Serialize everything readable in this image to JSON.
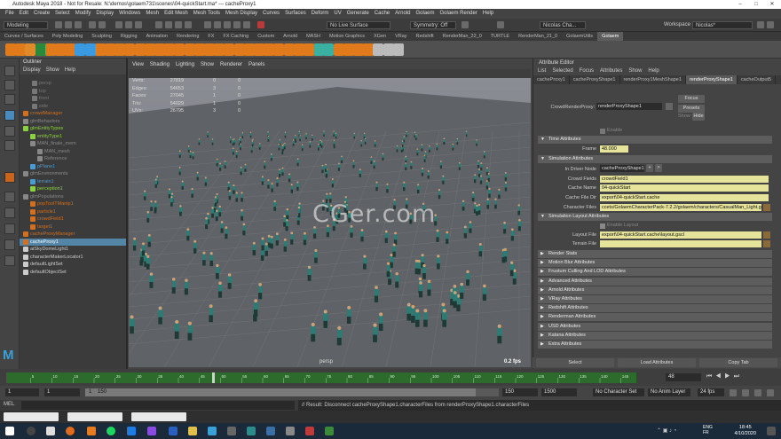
{
  "window": {
    "title": "Autodesk Maya 2018 - Not for Resale: N:\\demos\\golaem731\\scenes\\04-quickStart.ma* --- cacheProxy1"
  },
  "menubar": [
    "File",
    "Edit",
    "Create",
    "Select",
    "Modify",
    "Display",
    "Windows",
    "Mesh",
    "Edit Mesh",
    "Mesh Tools",
    "Mesh Display",
    "Curves",
    "Surfaces",
    "Deform",
    "UV",
    "Generate",
    "Cache",
    "Arnold",
    "Golaem",
    "Golaem Render",
    "Help"
  ],
  "status": {
    "mode": "Modeling",
    "no_live_surface": "No Live Surface",
    "symmetry": "Symmetry: Off",
    "user": "Nicolas Cha...",
    "workspace_label": "Workspace :",
    "workspace": "Nicolas*"
  },
  "shelf_tabs": [
    "Curves / Surfaces",
    "Poly Modeling",
    "Sculpting",
    "Rigging",
    "Animation",
    "Rendering",
    "FX",
    "FX Caching",
    "Custom",
    "Arnold",
    "MASH",
    "Motion Graphics",
    "XGen",
    "VRay",
    "Redshift",
    "RenderMan_22_0",
    "TURTLE",
    "RenderMan_21_0",
    "GolaemUtils",
    "Golaem"
  ],
  "shelf_active": "Golaem",
  "outliner": {
    "title": "Outliner",
    "menu": [
      "Display",
      "Show",
      "Help"
    ],
    "items": [
      {
        "label": "persp",
        "color": "#777"
      },
      {
        "label": "top",
        "color": "#777"
      },
      {
        "label": "front",
        "color": "#777"
      },
      {
        "label": "side",
        "color": "#777"
      },
      {
        "label": "crowdManager",
        "color": "#d07020"
      },
      {
        "label": "glmBehaviors",
        "color": "#888"
      },
      {
        "label": "glmEntityTypes",
        "color": "#8bd040"
      },
      {
        "label": "entityType1",
        "color": "#8bd040"
      },
      {
        "label": "MAN_finale_mem",
        "color": "#888"
      },
      {
        "label": "MAN_mesh",
        "color": "#888"
      },
      {
        "label": "Reference",
        "color": "#888"
      },
      {
        "label": "pPlane1",
        "color": "#4a9bd0"
      },
      {
        "label": "glmEnvironments",
        "color": "#888"
      },
      {
        "label": "terrain1",
        "color": "#4a9bd0"
      },
      {
        "label": "perception1",
        "color": "#8bd040"
      },
      {
        "label": "glmPopulations",
        "color": "#888"
      },
      {
        "label": "popToolTManip1",
        "color": "#d07020"
      },
      {
        "label": "particle1",
        "color": "#d07020"
      },
      {
        "label": "crowdField1",
        "color": "#d07020"
      },
      {
        "label": "target1",
        "color": "#d07020"
      },
      {
        "label": "cacheProxyManager",
        "color": "#d07020"
      },
      {
        "label": "cacheProxy1",
        "color": "#d07020",
        "selected": true
      },
      {
        "label": "aiSkyDomeLight1",
        "color": "#ccc"
      },
      {
        "label": "characterMakerLocator1",
        "color": "#ccc"
      },
      {
        "label": "defaultLightSet",
        "color": "#ccc"
      },
      {
        "label": "defaultObjectSet",
        "color": "#ccc"
      }
    ]
  },
  "viewport": {
    "menu": [
      "View",
      "Shading",
      "Lighting",
      "Show",
      "Renderer",
      "Panels"
    ],
    "hud": [
      {
        "name": "Verts:",
        "v1": "27819",
        "v2": "0",
        "v3": "0"
      },
      {
        "name": "Edges:",
        "v1": "54653",
        "v2": "3",
        "v3": "0"
      },
      {
        "name": "Faces:",
        "v1": "27045",
        "v2": "1",
        "v3": "0"
      },
      {
        "name": "Tris:",
        "v1": "54029",
        "v2": "1",
        "v3": "0"
      },
      {
        "name": "UVs:",
        "v1": "26795",
        "v2": "3",
        "v3": "0"
      }
    ],
    "camera": "persp",
    "fps": "0.2 fps",
    "watermark": "CGer.com"
  },
  "attr": {
    "title": "Attribute Editor",
    "menu": [
      "List",
      "Selected",
      "Focus",
      "Attributes",
      "Show",
      "Help"
    ],
    "tabs": [
      "cacheProxy1",
      "cacheProxyShape1",
      "renderProxy1MeshShape1",
      "renderProxyShape1",
      "cacheOutput5"
    ],
    "active_tab": "renderProxyShape1",
    "node_label": "CrowdRenderProxy:",
    "node_value": "renderProxyShape1",
    "focus": "Focus",
    "presets": "Presets",
    "show": "Show",
    "hide": "Hide",
    "enable": "Enable",
    "sections": {
      "time": "Time Attributes",
      "frame_label": "Frame",
      "frame": "48.000",
      "sim": "Simulation Attributes",
      "driver_label": "In Driver Node",
      "driver": "cacheProxyShape1",
      "fields_label": "Crowd Fields",
      "fields": "crowdField1",
      "cache_name_label": "Cache Name",
      "cache_name": "04-quickStart",
      "cache_dir_label": "Cache File Dir",
      "cache_dir": "export\\04-quickStart.cache",
      "char_files_label": "Character Files",
      "char_files": "ccets/GolaemCharacterPack-7.2.2/golaem/characters/CasualMan_Light.gcha",
      "layout": "Simulation Layout Attributes",
      "enable_layout": "Enable Layout",
      "layout_file_label": "Layout File",
      "layout_file": "export\\04-quickStart.cache\\layout.gscl",
      "terrain_label": "Terrain File"
    },
    "collapsed": [
      "Render Stats",
      "Motion Blur Attributes",
      "Frustum Culling And LOD Attributes",
      "Advanced Attributes",
      "Arnold Attributes",
      "VRay Attributes",
      "Redshift Attributes",
      "Renderman Attributes",
      "USD Attributes",
      "Katana Attributes",
      "Extra Attributes"
    ],
    "footer": [
      "Select",
      "Load Attributes",
      "Copy Tab"
    ]
  },
  "timeline": {
    "current": "48",
    "ticks": [
      "5",
      "10",
      "15",
      "20",
      "25",
      "30",
      "35",
      "40",
      "45",
      "50",
      "55",
      "60",
      "65",
      "70",
      "75",
      "80",
      "85",
      "90",
      "95",
      "100",
      "105",
      "110",
      "115",
      "120",
      "125",
      "130",
      "135",
      "140",
      "145"
    ]
  },
  "range": {
    "start": "1",
    "start2": "1",
    "mid": "1",
    "end_slider": "150",
    "end": "150",
    "end2": "1500",
    "character_set": "No Character Set",
    "anim_layer": "No Anim Layer",
    "fps": "24 fps"
  },
  "cmd": {
    "mel": "MEL",
    "result": "// Result: Disconnect cacheProxyShape1.characterFiles from renderProxyShape1.characterFiles"
  },
  "clock": {
    "lang": "ENG\nFR",
    "time": "18:45",
    "date": "4/10/2020"
  },
  "colors": {
    "accent": "#5285a6",
    "field": "#e6e39a",
    "timeline": "#2d6b2d"
  }
}
